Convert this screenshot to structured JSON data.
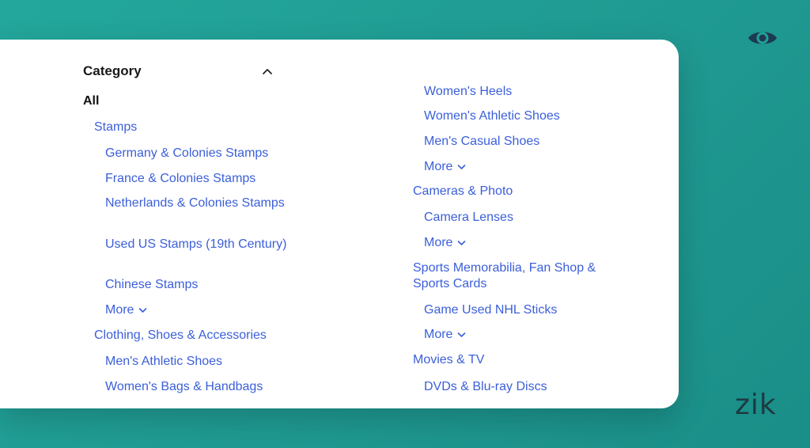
{
  "filter": {
    "title": "Category",
    "all_label": "All",
    "left_column": [
      {
        "label": "Stamps",
        "level": 1
      },
      {
        "label": "Germany & Colonies Stamps",
        "level": 2
      },
      {
        "label": "France & Colonies Stamps",
        "level": 2
      },
      {
        "label": "Netherlands & Colonies Stamps",
        "level": 2
      },
      {
        "label": "Used US Stamps (19th Century)",
        "level": 2
      },
      {
        "label": "Chinese Stamps",
        "level": 2
      },
      {
        "label": "More",
        "level": 2,
        "more": true
      },
      {
        "label": "Clothing, Shoes & Accessories",
        "level": 1
      },
      {
        "label": "Men's Athletic Shoes",
        "level": 2
      },
      {
        "label": "Women's Bags & Handbags",
        "level": 2
      }
    ],
    "right_column": [
      {
        "label": "Women's Heels",
        "level": 2
      },
      {
        "label": "Women's Athletic Shoes",
        "level": 2
      },
      {
        "label": "Men's Casual Shoes",
        "level": 2
      },
      {
        "label": "More",
        "level": 2,
        "more": true
      },
      {
        "label": "Cameras & Photo",
        "level": 1
      },
      {
        "label": "Camera Lenses",
        "level": 2
      },
      {
        "label": "More",
        "level": 2,
        "more": true
      },
      {
        "label": "Sports Memorabilia, Fan Shop & Sports Cards",
        "level": 1
      },
      {
        "label": "Game Used NHL Sticks",
        "level": 2
      },
      {
        "label": "More",
        "level": 2,
        "more": true
      },
      {
        "label": "Movies & TV",
        "level": 1
      },
      {
        "label": "DVDs & Blu-ray Discs",
        "level": 2
      }
    ]
  },
  "branding": {
    "logo_text": "zik",
    "eye_icon": "eye-icon"
  },
  "colors": {
    "background": "#21a198",
    "link": "#3b5fd9",
    "heading": "#191919",
    "logo": "#1d3a40"
  }
}
